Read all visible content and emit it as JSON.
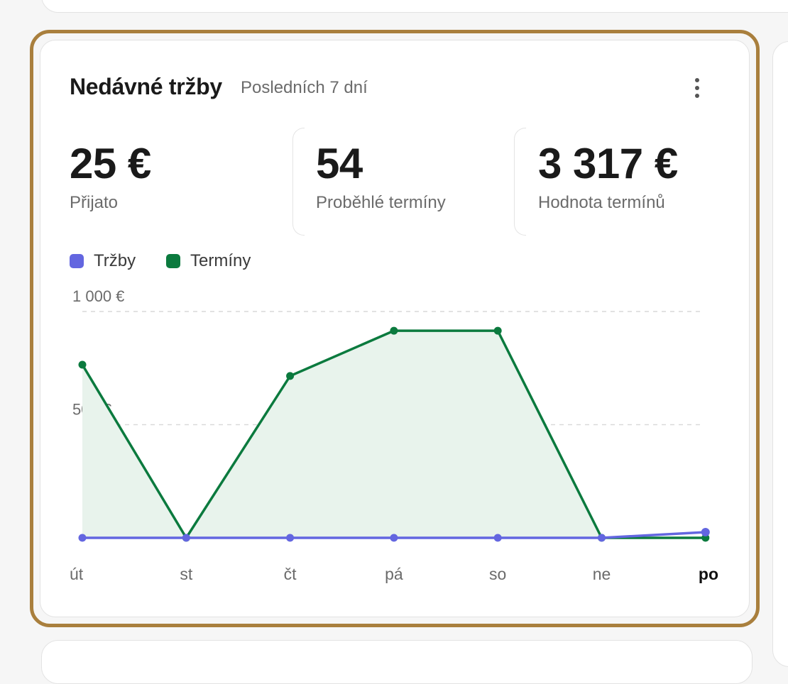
{
  "widget": {
    "title": "Nedávné tržby",
    "subtitle": "Posledních 7 dní",
    "menu_icon": "more-vertical-icon"
  },
  "stats": [
    {
      "value": "25 €",
      "label": "Přijato"
    },
    {
      "value": "54",
      "label": "Proběhlé termíny"
    },
    {
      "value": "3 317 €",
      "label": "Hodnota termínů"
    }
  ],
  "legend": [
    {
      "label": "Tržby",
      "color": "#6366e0"
    },
    {
      "label": "Termíny",
      "color": "#0b7a3e"
    }
  ],
  "chart_data": {
    "type": "line",
    "categories": [
      "út",
      "st",
      "čt",
      "pá",
      "so",
      "ne",
      "po"
    ],
    "highlighted_category": "po",
    "y_ticks": [
      {
        "value": 1000,
        "label": "1 000 €"
      },
      {
        "value": 500,
        "label": "500 €"
      }
    ],
    "ylim": [
      0,
      1000
    ],
    "grid": true,
    "legend_position": "top-left",
    "series": [
      {
        "name": "Termíny",
        "color": "#0b7a3e",
        "fill": "#e8f3ec",
        "area": true,
        "values": [
          765,
          0,
          715,
          915,
          915,
          0,
          0
        ]
      },
      {
        "name": "Tržby",
        "color": "#6366e0",
        "area": false,
        "values": [
          0,
          0,
          0,
          0,
          0,
          0,
          25
        ]
      }
    ]
  }
}
